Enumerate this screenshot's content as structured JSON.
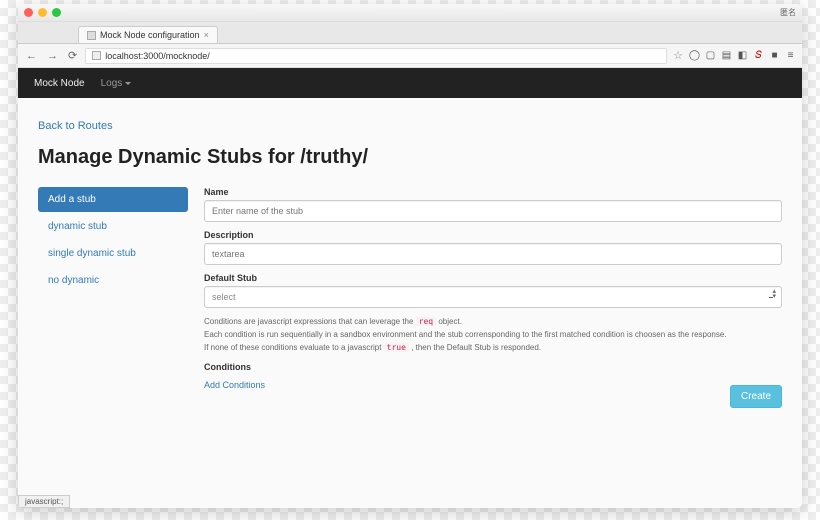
{
  "browser": {
    "tab_title": "Mock Node configuration",
    "url_display": "localhost:3000/mocknode/",
    "titlebar_right": "匿名",
    "statusbar": "javascript:;"
  },
  "navbar": {
    "brand": "Mock Node",
    "menu_logs": "Logs"
  },
  "page": {
    "back_link": "Back to Routes",
    "heading": "Manage Dynamic Stubs for /truthy/"
  },
  "sidebar": {
    "items": [
      {
        "label": "Add a stub",
        "active": true
      },
      {
        "label": "dynamic stub",
        "active": false
      },
      {
        "label": "single dynamic stub",
        "active": false
      },
      {
        "label": "no dynamic",
        "active": false
      }
    ]
  },
  "form": {
    "name_label": "Name",
    "name_placeholder": "Enter name of the stub",
    "desc_label": "Description",
    "desc_placeholder": "textarea",
    "default_label": "Default Stub",
    "default_value": "select",
    "help_line1_a": "Conditions are javascript expressions that can leverage the ",
    "help_line1_code": "req",
    "help_line1_b": " object.",
    "help_line2": "Each condition is run sequentially in a sandbox environment and the stub corrensponding to the first matched condition is choosen as the response.",
    "help_line3_a": "If none of these conditions evaluate to a javascript ",
    "help_line3_code": "true",
    "help_line3_b": " , then the Default Stub is responded.",
    "conditions_label": "Conditions",
    "add_conditions": "Add Conditions",
    "create_btn": "Create"
  }
}
